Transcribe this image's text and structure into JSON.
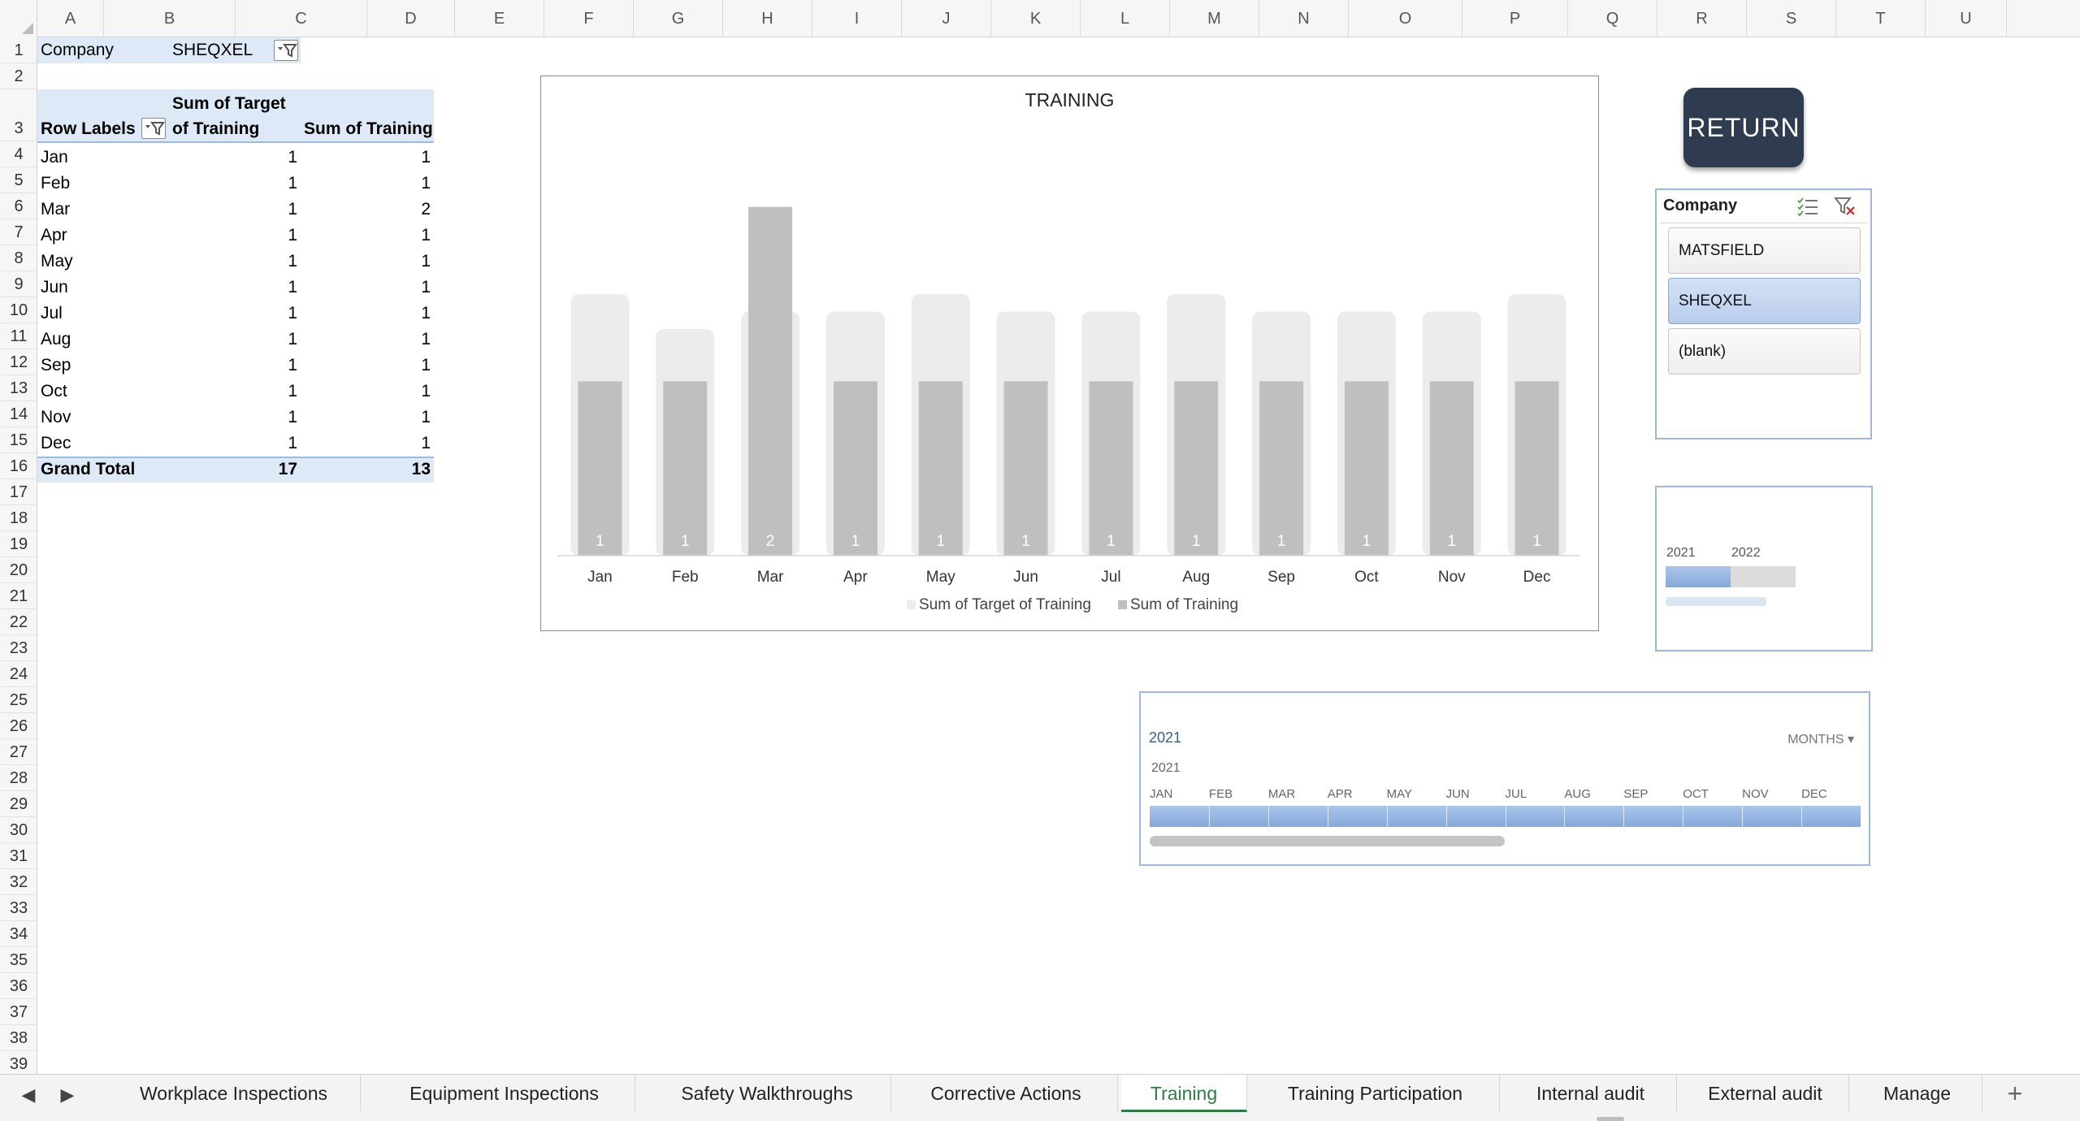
{
  "columns": [
    "A",
    "B",
    "C",
    "D",
    "E",
    "F",
    "G",
    "H",
    "I",
    "J",
    "K",
    "L",
    "M",
    "N",
    "O",
    "P",
    "Q",
    "R",
    "S",
    "T",
    "U"
  ],
  "rows": [
    "1",
    "2",
    "3",
    "4",
    "5",
    "6",
    "7",
    "8",
    "9",
    "10",
    "11",
    "12",
    "13",
    "14",
    "15",
    "16",
    "17",
    "18",
    "19",
    "20",
    "21",
    "22",
    "23",
    "24",
    "25",
    "26",
    "27",
    "28",
    "29",
    "30",
    "31",
    "32",
    "33",
    "34",
    "35",
    "36",
    "37",
    "38",
    "39"
  ],
  "pivot": {
    "filter_label": "Company",
    "filter_value": "SHEQXEL",
    "header_row_labels": "Row Labels",
    "header_target_line1": "Sum of Target",
    "header_target_line2": "of Training",
    "header_training": "Sum of Training",
    "rows": [
      {
        "label": "Jan",
        "target": "1",
        "training": "1"
      },
      {
        "label": "Feb",
        "target": "1",
        "training": "1"
      },
      {
        "label": "Mar",
        "target": "1",
        "training": "2"
      },
      {
        "label": "Apr",
        "target": "1",
        "training": "1"
      },
      {
        "label": "May",
        "target": "1",
        "training": "1"
      },
      {
        "label": "Jun",
        "target": "1",
        "training": "1"
      },
      {
        "label": "Jul",
        "target": "1",
        "training": "1"
      },
      {
        "label": "Aug",
        "target": "1",
        "training": "1"
      },
      {
        "label": "Sep",
        "target": "1",
        "training": "1"
      },
      {
        "label": "Oct",
        "target": "1",
        "training": "1"
      },
      {
        "label": "Nov",
        "target": "1",
        "training": "1"
      },
      {
        "label": "Dec",
        "target": "1",
        "training": "1"
      }
    ],
    "total_label": "Grand Total",
    "total_target": "17",
    "total_training": "13"
  },
  "chart_data": {
    "type": "bar",
    "title": "TRAINING",
    "categories": [
      "Jan",
      "Feb",
      "Mar",
      "Apr",
      "May",
      "Jun",
      "Jul",
      "Aug",
      "Sep",
      "Oct",
      "Nov",
      "Dec"
    ],
    "series": [
      {
        "name": "Sum of Target of Training",
        "values": [
          1.5,
          1.3,
          1.4,
          1.4,
          1.5,
          1.4,
          1.4,
          1.5,
          1.4,
          1.4,
          1.4,
          1.5
        ],
        "color": "#ececec"
      },
      {
        "name": "Sum of Training",
        "values": [
          1,
          1,
          2,
          1,
          1,
          1,
          1,
          1,
          1,
          1,
          1,
          1
        ],
        "color": "#bfbfbf"
      }
    ],
    "data_labels": [
      "1",
      "1",
      "2",
      "1",
      "1",
      "1",
      "1",
      "1",
      "1",
      "1",
      "1",
      "1"
    ],
    "ylim": [
      0,
      2.05
    ],
    "grid": false,
    "legend_position": "bottom"
  },
  "return_button": "RETURN",
  "slicer": {
    "title": "Company",
    "items": [
      "MATSFIELD",
      "SHEQXEL",
      "(blank)"
    ],
    "selected": "SHEQXEL"
  },
  "year_box": {
    "years": [
      "2021",
      "2022"
    ]
  },
  "timeline": {
    "selected_label": "2021",
    "level": "MONTHS",
    "year": "2021",
    "months": [
      "JAN",
      "FEB",
      "MAR",
      "APR",
      "MAY",
      "JUN",
      "JUL",
      "AUG",
      "SEP",
      "OCT",
      "NOV",
      "DEC"
    ]
  },
  "tabs": [
    "Workplace Inspections",
    "Equipment Inspections",
    "Safety Walkthroughs",
    "Corrective Actions",
    "Training",
    "Training Participation",
    "Internal audit",
    "External audit",
    "Manage"
  ],
  "active_tab": "Training",
  "colors": {
    "accent_green": "#2e7d46",
    "pivot_highlight": "#dde9f6",
    "slicer_selected": "#b9cdec",
    "button_dark": "#2f3b4e"
  }
}
